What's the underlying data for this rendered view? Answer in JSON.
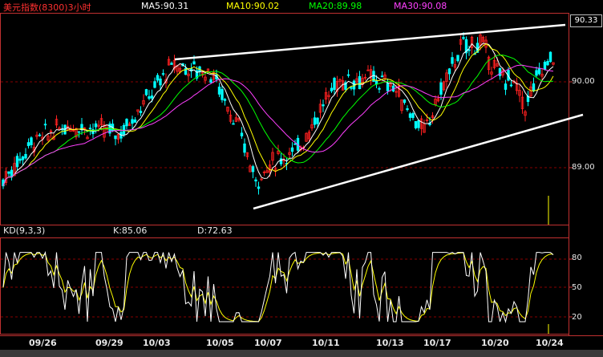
{
  "header": {
    "title": "美元指数(8300)3小时",
    "ma5": "MA5:90.31",
    "ma10": "MA10:90.02",
    "ma20": "MA20:89.98",
    "ma30": "MA30:90.08"
  },
  "kd_header": {
    "label": "KD(9,3,3)",
    "k": "K:85.06",
    "d": "D:72.63"
  },
  "last_price_box": "90.33",
  "colors": {
    "ma5": "#ffffff",
    "ma10": "#ffff00",
    "ma20": "#00ff00",
    "ma30": "#ff40ff",
    "up": "#ff2020",
    "down": "#00ffff",
    "grid": "#880000",
    "k_line": "#ffffff",
    "d_line": "#ffff00"
  },
  "chart_data": [
    {
      "type": "candlestick",
      "title": "美元指数(8300)3小时",
      "ylabels": [
        "90.00",
        "89.00"
      ],
      "ylim": [
        88.5,
        90.75
      ],
      "xlabels": [
        "09/26",
        "09/29",
        "10/03",
        "10/05",
        "10/07",
        "10/11",
        "10/13",
        "10/17",
        "10/20",
        "10/24"
      ],
      "grid": true,
      "series": [
        {
          "name": "MA5",
          "last": 90.31
        },
        {
          "name": "MA10",
          "last": 90.02
        },
        {
          "name": "MA20",
          "last": 89.98
        },
        {
          "name": "MA30",
          "last": 90.08
        }
      ]
    },
    {
      "type": "line",
      "title": "KD(9,3,3)",
      "ylabels": [
        "80",
        "50",
        "20"
      ],
      "ylim": [
        0,
        100
      ],
      "series": [
        {
          "name": "K",
          "last": 85.06
        },
        {
          "name": "D",
          "last": 72.63
        }
      ]
    }
  ]
}
